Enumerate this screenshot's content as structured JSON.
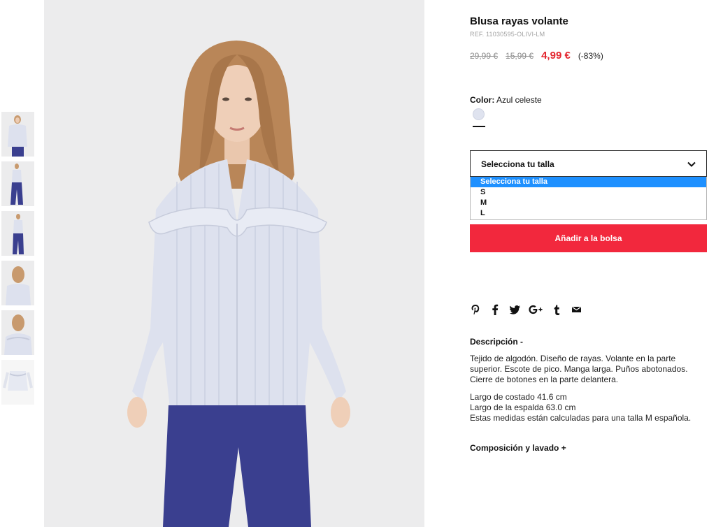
{
  "product": {
    "title": "Blusa rayas volante",
    "ref": "REF. 11030595-OLIVI-LM",
    "prices": {
      "original": "29,99 €",
      "previous": "15,99 €",
      "current": "4,99 €",
      "discount": "(-83%)"
    },
    "color": {
      "label": "Color:",
      "value": "Azul celeste",
      "swatch_hex": "#dfe3ef"
    },
    "size_select": {
      "placeholder": "Selecciona tu talla",
      "options": [
        "Selecciona tu talla",
        "S",
        "M",
        "L"
      ],
      "highlighted": "Selecciona tu talla"
    },
    "add_to_bag": "Añadir a la bolsa",
    "share_icons": [
      "pinterest-icon",
      "facebook-icon",
      "twitter-icon",
      "google-plus-icon",
      "tumblr-icon",
      "email-icon"
    ],
    "description": {
      "heading": "Descripción -",
      "paragraph1": "Tejido de algodón. Diseño de rayas. Volante en la parte superior. Escote de pico. Manga larga. Puños abotonados. Cierre de botones en la parte delantera.",
      "line1": "Largo de costado 41.6 cm",
      "line2": "Largo de la espalda 63.0 cm",
      "line3": "Estas medidas están calculadas para una talla M española."
    },
    "composition_heading": "Composición y lavado +"
  },
  "colors": {
    "accent_red": "#f2283d",
    "price_red": "#e3262f",
    "dropdown_highlight": "#1e90ff",
    "image_background": "#ececed",
    "blouse": "#dde1ee",
    "trousers": "#3a3f8f"
  },
  "gallery": {
    "thumbnail_count": 6
  }
}
